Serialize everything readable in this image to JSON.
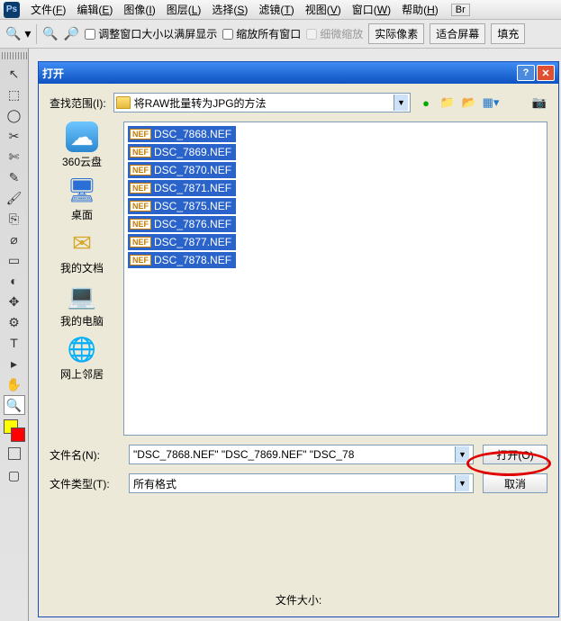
{
  "menubar": {
    "items": [
      {
        "label": "文件",
        "key": "F"
      },
      {
        "label": "编辑",
        "key": "E"
      },
      {
        "label": "图像",
        "key": "I"
      },
      {
        "label": "图层",
        "key": "L"
      },
      {
        "label": "选择",
        "key": "S"
      },
      {
        "label": "滤镜",
        "key": "T"
      },
      {
        "label": "视图",
        "key": "V"
      },
      {
        "label": "窗口",
        "key": "W"
      },
      {
        "label": "帮助",
        "key": "H"
      }
    ],
    "br_label": "Br"
  },
  "toolbar": {
    "resize_label": "调整窗口大小以满屏显示",
    "zoom_all_label": "缩放所有窗口",
    "fine_zoom_label": "细微缩放",
    "actual_pixels_btn": "实际像素",
    "fit_screen_btn": "适合屏幕",
    "fill_btn": "填充"
  },
  "tools": [
    "↖",
    "⬚",
    "◯",
    "✂",
    "✄",
    "✎",
    "🖌",
    "⎘",
    "⌀",
    "▭",
    "◐",
    "✥",
    "⚙",
    "T",
    "▸",
    "✋",
    "🔍"
  ],
  "dialog": {
    "title": "打开",
    "lookup_label": "查找范围(I):",
    "folder_name": "将RAW批量转为JPG的方法",
    "places": [
      {
        "label": "360云盘"
      },
      {
        "label": "桌面"
      },
      {
        "label": "我的文档"
      },
      {
        "label": "我的电脑"
      },
      {
        "label": "网上邻居"
      }
    ],
    "files": [
      "DSC_7868.NEF",
      "DSC_7869.NEF",
      "DSC_7870.NEF",
      "DSC_7871.NEF",
      "DSC_7875.NEF",
      "DSC_7876.NEF",
      "DSC_7877.NEF",
      "DSC_7878.NEF"
    ],
    "filename_label": "文件名(N):",
    "filename_value": "\"DSC_7868.NEF\" \"DSC_7869.NEF\" \"DSC_78",
    "filetype_label": "文件类型(T):",
    "filetype_value": "所有格式",
    "open_btn": "打开(O)",
    "cancel_btn": "取消",
    "filesize_label": "文件大小:",
    "nef_badge": "NEF"
  }
}
